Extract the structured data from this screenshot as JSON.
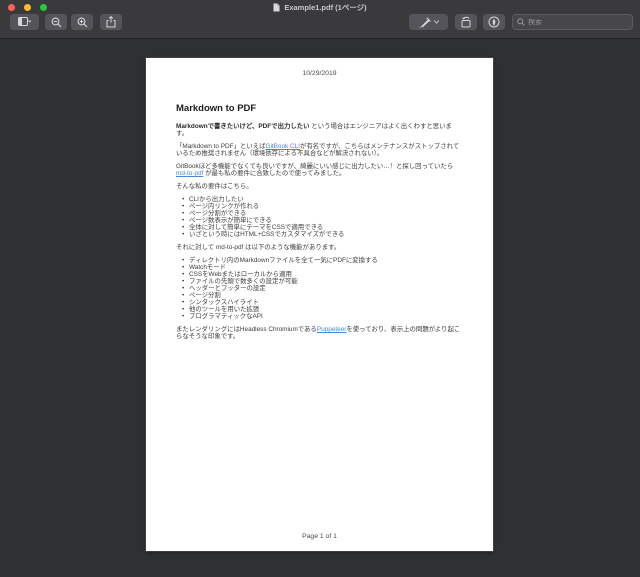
{
  "window": {
    "title": "Example1.pdf (1ページ)",
    "traffic_lights": [
      "close",
      "minimize",
      "fullscreen"
    ]
  },
  "toolbar": {
    "icons": {
      "sidebar": "sidebar-view-icon",
      "zoom_out": "magnifier-minus-icon",
      "zoom_in": "magnifier-plus-icon",
      "share": "share-icon",
      "highlight": "highlighter-pen-icon",
      "highlight_chevron": "chevron-down-icon",
      "rotate": "rotate-left-icon",
      "markup": "markup-pen-circle-icon",
      "search": "search-icon"
    },
    "search": {
      "placeholder": "検索",
      "value": ""
    }
  },
  "colors": {
    "chrome_bg": "#3a3a3c",
    "content_bg": "#2e3033",
    "button_bg": "#54545a",
    "page_bg": "#ffffff",
    "link": "#4a87d5",
    "traffic_red": "#ff5f57",
    "traffic_yellow": "#febc2e",
    "traffic_green": "#28c840"
  },
  "document": {
    "date": "10/29/2019",
    "title": "Markdown to PDF",
    "p1_bold": "Markdownで書きたいけど、PDFで出力したい",
    "p1_rest": " という場合はエンジニアはよく出くわすと思います。",
    "p2_pre": "「Markdown to PDF」といえば",
    "p2_link": "GitBook CLI",
    "p2_post": "が有名ですが、こちらはメンテナンスがストップされているため推奨されません（環境依存による不具合などが解決されない）。",
    "p3_pre": "GitBookほど多機能でなくても良いですが、綺麗にいい感じに出力したい…！と探し回っていたら ",
    "p3_link": "md-to-pdf",
    "p3_post": " が最も私の要件に合致したので使ってみました。",
    "p4": "そんな私の要件はこちら。",
    "list1": [
      "CLIから出力したい",
      "ページ内リンクが作れる",
      "ページ分割ができる",
      "ページ数表示が簡単にできる",
      "全体に対して簡単にテーマをCSSで適用できる",
      "いざという時にはHTML+CSSでカスタマイズができる"
    ],
    "p5": "それに対して md-to-pdf は以下のような機能があります。",
    "list2": [
      "ディレクトリ内のMarkdownファイルを全て一気にPDFに変換する",
      "Watchモード",
      "CSSをWebまたはローカルから適用",
      "ファイルの先頭で数多くの設定が可能",
      "ヘッダーとフッターの設定",
      "ページ分割",
      "シンタックスハイライト",
      "他のツールを用いた拡張",
      "プログラマティックなAPI"
    ],
    "p6_pre": "またレンダリングにはHeadless Chromiumである",
    "p6_link": "Puppeteer",
    "p6_post": "を使っており、表示上の問題がより起こらなそうな印象です。",
    "footer": "Page 1 of 1"
  }
}
